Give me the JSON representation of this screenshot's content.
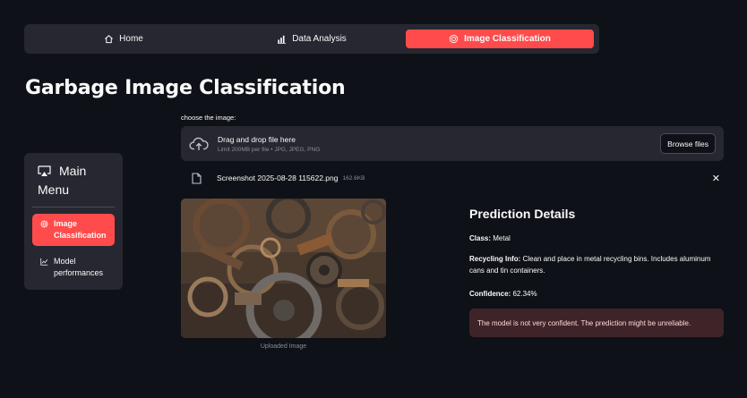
{
  "nav": {
    "tabs": [
      {
        "label": "Home",
        "icon": "home-icon"
      },
      {
        "label": "Data Analysis",
        "icon": "bar-chart-icon"
      },
      {
        "label": "Image Classification",
        "icon": "target-icon",
        "active": true
      }
    ]
  },
  "page": {
    "title": "Garbage Image Classification"
  },
  "sidebar": {
    "title_line1": "Main",
    "title_line2": "Menu",
    "items": [
      {
        "label_line1": "Image",
        "label_line2": "Classification",
        "icon": "target-icon",
        "active": true
      },
      {
        "label_line1": "Model",
        "label_line2": "performances",
        "icon": "line-chart-icon"
      }
    ]
  },
  "uploader": {
    "label": "choose the image:",
    "drop_text": "Drag and drop file here",
    "limit_text": "Limit 200MB per file • JPG, JPEG, PNG",
    "browse_label": "Browse files",
    "file": {
      "name": "Screenshot 2025-08-28 115622.png",
      "size": "162.6KB"
    },
    "remove_label": "✕"
  },
  "image": {
    "caption": "Uploaded Image"
  },
  "prediction": {
    "title": "Prediction Details",
    "class_label": "Class:",
    "class_value": "Metal",
    "recycling_label": "Recycling Info:",
    "recycling_value": "Clean and place in metal recycling bins. Includes aluminum cans and tin containers.",
    "confidence_label": "Confidence:",
    "confidence_value": "62.34%",
    "warning": "The model is not very confident. The prediction might be unreliable."
  },
  "colors": {
    "accent": "#ff4b4b",
    "background": "#0e1117",
    "panel": "#262730",
    "warning_bg": "#3e2428"
  }
}
